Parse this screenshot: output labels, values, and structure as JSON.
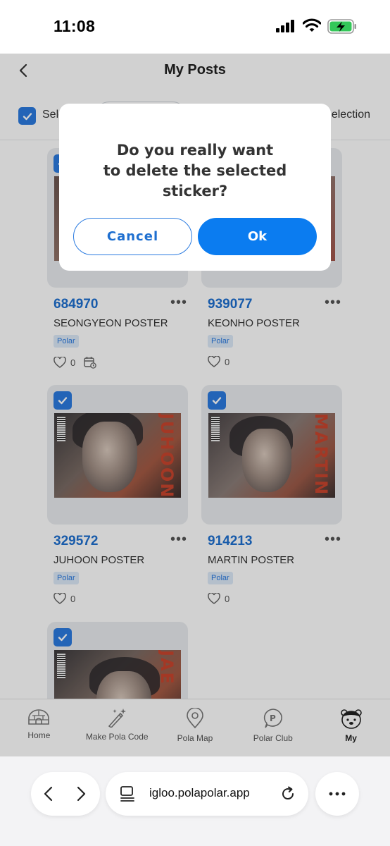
{
  "status_bar": {
    "time": "11:08"
  },
  "header": {
    "title": "My Posts"
  },
  "select_row": {
    "select_all_label": "Sele",
    "delete_label": "election"
  },
  "posts": [
    {
      "id": "684970",
      "title": "SEONGYEON POSTER",
      "tag": "Polar",
      "likes": "0",
      "poster_text": "",
      "has_calendar": true
    },
    {
      "id": "939077",
      "title": "KEONHO POSTER",
      "tag": "Polar",
      "likes": "0",
      "poster_text": "",
      "has_calendar": false
    },
    {
      "id": "329572",
      "title": "JUHOON POSTER",
      "tag": "Polar",
      "likes": "0",
      "poster_text": "JUHOON",
      "has_calendar": false
    },
    {
      "id": "914213",
      "title": "MARTIN POSTER",
      "tag": "Polar",
      "likes": "0",
      "poster_text": "MARTIN",
      "has_calendar": false
    },
    {
      "id": "",
      "title": "",
      "tag": "",
      "likes": "",
      "poster_text": "JAE",
      "has_calendar": false
    }
  ],
  "bottom_nav": [
    {
      "label": "Home",
      "icon": "igloo-icon"
    },
    {
      "label": "Make Pola Code",
      "icon": "magic-wand-icon"
    },
    {
      "label": "Pola Map",
      "icon": "map-pin-icon"
    },
    {
      "label": "Polar Club",
      "icon": "polar-club-icon"
    },
    {
      "label": "My",
      "icon": "bear-avatar-icon"
    }
  ],
  "dialog": {
    "message": "Do you really want\nto delete the selected\nsticker?",
    "cancel_label": "Cancel",
    "ok_label": "Ok"
  },
  "browser": {
    "url": "igloo.polapolar.app"
  },
  "colors": {
    "accent": "#0b7cf0",
    "check": "#2b7be0",
    "id_text": "#1e6fd0"
  }
}
